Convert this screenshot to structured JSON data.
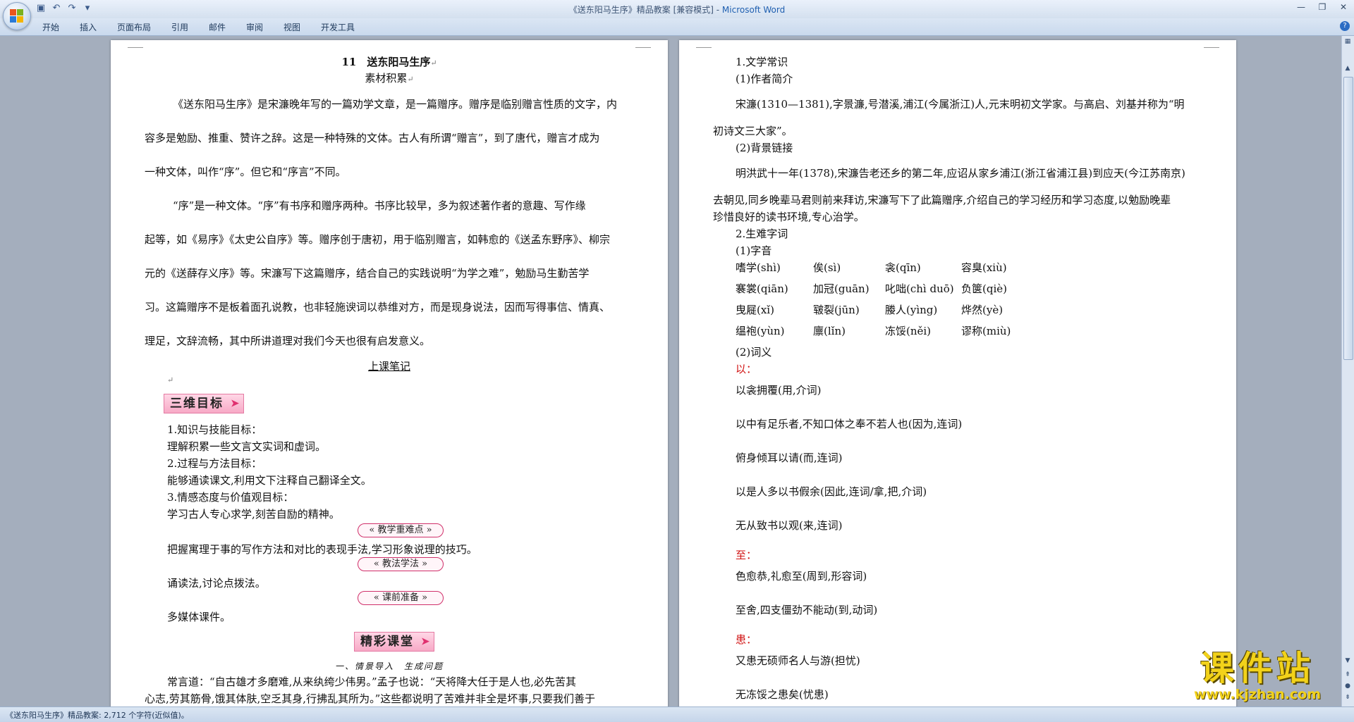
{
  "window": {
    "title": "《送东阳马生序》精品教案 [兼容模式] - ",
    "app": "Microsoft Word"
  },
  "ribbon": {
    "tabs": [
      "开始",
      "插入",
      "页面布局",
      "引用",
      "邮件",
      "审阅",
      "视图",
      "开发工具"
    ]
  },
  "left_page": {
    "title": "11　送东阳马生序",
    "subtitle": "素材积累",
    "paragraphs": [
      "《送东阳马生序》是宋濂晚年写的一篇劝学文章，是一篇赠序。赠序是临别赠言性质的文字，内",
      "容多是勉励、推重、赞许之辞。这是一种特殊的文体。古人有所谓“赠言”，到了唐代，赠言才成为",
      "一种文体，叫作“序”。但它和“序言”不同。",
      "“序”是一种文体。“序”有书序和赠序两种。书序比较早，多为叙述著作者的意趣、写作缘",
      "起等，如《易序》《太史公自序》等。赠序创于唐初，用于临别赠言，如韩愈的《送孟东野序》、柳宗",
      "元的《送薛存义序》等。宋濂写下这篇赠序，结合自己的实践说明“为学之难”，勉励马生勤苦学",
      "习。这篇赠序不是板着面孔说教，也非轻施谀词以恭维对方，而是现身说法，因而写得事信、情真、",
      "理足，文辞流畅，其中所讲道理对我们今天也很有启发意义。"
    ],
    "notes_heading": "上课笔记",
    "banner1": "三维目标",
    "goals": [
      "1.知识与技能目标：",
      "理解积累一些文言文实词和虚词。",
      "2.过程与方法目标：",
      "能够通读课文,利用文下注释自己翻译全文。",
      "3.情感态度与价值观目标：",
      "学习古人专心求学,刻苦自励的精神。"
    ],
    "pill1": "教学重难点",
    "key_points": "把握寓理于事的写作方法和对比的表现手法,学习形象说理的技巧。",
    "pill2": "教法学法",
    "methods": "诵读法,讨论点拨法。",
    "pill3": "课前准备",
    "prep": "多媒体课件。",
    "banner2": "精彩课堂",
    "section_heading": "一、情景导入　生成问题",
    "intro_lines": [
      "常言道：“自古雄才多磨难,从来纨绔少伟男。”孟子也说：“天将降大任于是人也,必先苦其",
      "心志,劳其筋骨,饿其体肤,空乏其身,行拂乱其所为。”这些都说明了苦难并非全是坏事,只要我们善于"
    ]
  },
  "right_page": {
    "lines": [
      "1.文学常识",
      "(1)作者简介",
      "宋濂(1310—1381),字景濂,号潜溪,浦江(今属浙江)人,元末明初文学家。与高启、刘基并称为“明",
      "初诗文三大家”。",
      "(2)背景链接",
      "明洪武十一年(1378),宋濂告老还乡的第二年,应诏从家乡浦江(浙江省浦江县)到应天(今江苏南京)",
      "去朝见,同乡晚辈马君则前来拜访,宋濂写下了此篇赠序,介绍自己的学习经历和学习态度,以勉励晚辈",
      "珍惜良好的读书环境,专心治学。",
      "2.生难字词",
      "(1)字音"
    ],
    "pinyin_rows": [
      [
        "嗜学(shì)",
        "俟(sì)",
        "衾(qīn)",
        "容臭(xiù)"
      ],
      [
        "褰裳(qiān)",
        "加冠(guān)",
        "叱咄(chì duō)",
        "负箧(qiè)"
      ],
      [
        "曳屣(xǐ)",
        "皲裂(jūn)",
        "媵人(yìng)",
        "烨然(yè)"
      ],
      [
        "缊袍(yùn)",
        "廪(lǐn)",
        "冻馁(něi)",
        "谬称(miù)"
      ]
    ],
    "meaning_heading": "(2)词义",
    "word1": "以：",
    "word1_items": [
      "以衾拥覆(用,介词)",
      "以中有足乐者,不知口体之奉不若人也(因为,连词)",
      "俯身倾耳以请(而,连词)",
      "以是人多以书假余(因此,连词/拿,把,介词)",
      "无从致书以观(来,连词)"
    ],
    "word2": "至：",
    "word2_items": [
      "色愈恭,礼愈至(周到,形容词)",
      "至舍,四支僵劲不能动(到,动词)"
    ],
    "word3": "患：",
    "word3_items": [
      "又患无硕师名人与游(担忧)",
      "无冻馁之患矣(忧患)"
    ]
  },
  "status": {
    "text": "《送东阳马生序》精品教案: 2,712 个字符(近似值)。"
  },
  "watermark": {
    "main": "课件站",
    "sub": "www.kjzhan.com"
  }
}
